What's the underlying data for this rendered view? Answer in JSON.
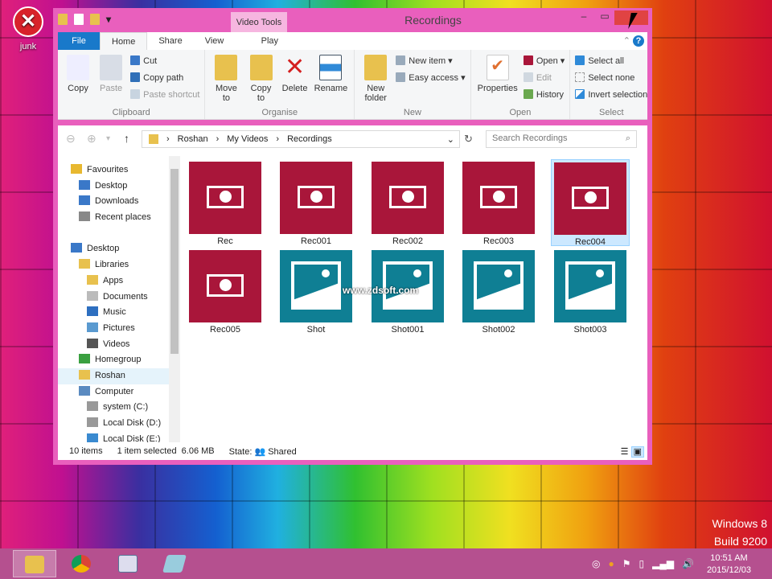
{
  "desktop": {
    "icon_label": "junk",
    "os_name": "Windows 8",
    "os_build": "Build 9200"
  },
  "window": {
    "title": "Recordings",
    "context_tab_group": "Video Tools",
    "tabs": [
      "File",
      "Home",
      "Share",
      "View",
      "Play"
    ],
    "ribbon": {
      "clipboard": {
        "label": "Clipboard",
        "copy": "Copy",
        "paste": "Paste",
        "cut": "Cut",
        "copy_path": "Copy path",
        "paste_shortcut": "Paste shortcut"
      },
      "organise": {
        "label": "Organise",
        "move_to": "Move to",
        "copy_to": "Copy to",
        "delete": "Delete",
        "rename": "Rename"
      },
      "new": {
        "label": "New",
        "new_folder": "New folder",
        "new_item": "New item",
        "easy_access": "Easy access"
      },
      "open": {
        "label": "Open",
        "properties": "Properties",
        "open": "Open",
        "edit": "Edit",
        "history": "History"
      },
      "select": {
        "label": "Select",
        "select_all": "Select all",
        "select_none": "Select none",
        "invert": "Invert selection"
      }
    },
    "breadcrumb": [
      "Roshan",
      "My Videos",
      "Recordings"
    ],
    "search_placeholder": "Search Recordings",
    "nav": [
      {
        "label": "Favourites",
        "level": 0,
        "color": "#e8b830"
      },
      {
        "label": "Desktop",
        "level": 1,
        "color": "#3a78c8"
      },
      {
        "label": "Downloads",
        "level": 1,
        "color": "#3a78c8"
      },
      {
        "label": "Recent places",
        "level": 1,
        "color": "#888"
      },
      {
        "label": "",
        "level": 0,
        "color": ""
      },
      {
        "label": "Desktop",
        "level": 0,
        "color": "#3a78c8"
      },
      {
        "label": "Libraries",
        "level": 1,
        "color": "#e8c14e"
      },
      {
        "label": "Apps",
        "level": 2,
        "color": "#e8c14e"
      },
      {
        "label": "Documents",
        "level": 2,
        "color": "#bbb"
      },
      {
        "label": "Music",
        "level": 2,
        "color": "#2d6fc0"
      },
      {
        "label": "Pictures",
        "level": 2,
        "color": "#5a9ad0"
      },
      {
        "label": "Videos",
        "level": 2,
        "color": "#555"
      },
      {
        "label": "Homegroup",
        "level": 1,
        "color": "#3aa040"
      },
      {
        "label": "Roshan",
        "level": 1,
        "color": "#e8c14e",
        "selected": true
      },
      {
        "label": "Computer",
        "level": 1,
        "color": "#5a8ac0"
      },
      {
        "label": "system (C:)",
        "level": 2,
        "color": "#999"
      },
      {
        "label": "Local Disk (D:)",
        "level": 2,
        "color": "#999"
      },
      {
        "label": "Local Disk (E:)",
        "level": 2,
        "color": "#3a8ad0"
      }
    ],
    "files": [
      {
        "name": "Rec",
        "type": "video"
      },
      {
        "name": "Rec001",
        "type": "video"
      },
      {
        "name": "Rec002",
        "type": "video"
      },
      {
        "name": "Rec003",
        "type": "video"
      },
      {
        "name": "Rec004",
        "type": "video",
        "selected": true
      },
      {
        "name": "Rec005",
        "type": "video"
      },
      {
        "name": "Shot",
        "type": "image"
      },
      {
        "name": "Shot001",
        "type": "image"
      },
      {
        "name": "Shot002",
        "type": "image"
      },
      {
        "name": "Shot003",
        "type": "image"
      }
    ],
    "status": {
      "count": "10 items",
      "selected": "1 item selected  6.06 MB",
      "state": "State:",
      "shared": "Shared"
    },
    "watermark": "www.zdsoft.com"
  },
  "taskbar": {
    "time": "10:51 AM",
    "date": "2015/12/03"
  }
}
